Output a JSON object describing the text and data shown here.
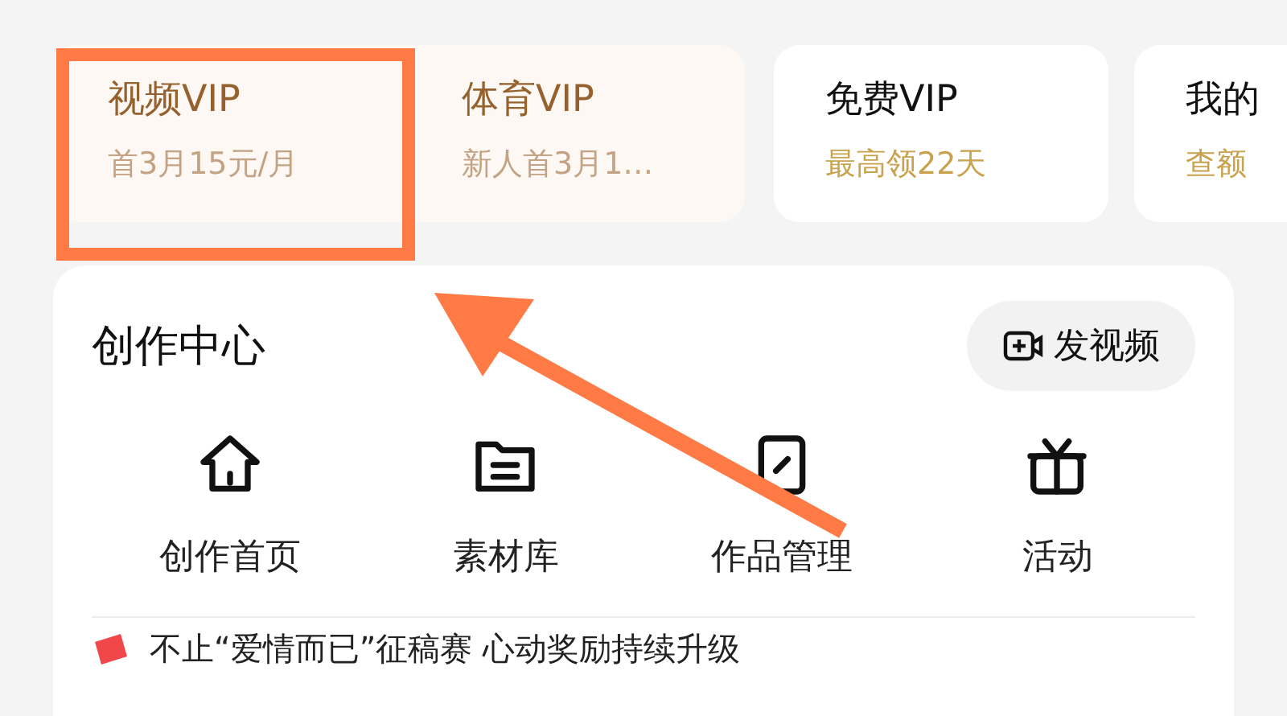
{
  "vip_cards": [
    {
      "title": "视频VIP",
      "subtitle": "首3月15元/月",
      "kind": "premium"
    },
    {
      "title": "体育VIP",
      "subtitle": "新人首3月1…",
      "kind": "premium"
    },
    {
      "title": "免费VIP",
      "subtitle": "最高领22天",
      "kind": "plain"
    },
    {
      "title": "我的",
      "subtitle": "查额",
      "kind": "plain"
    }
  ],
  "creation_center": {
    "title": "创作中心",
    "action_button": {
      "label": "发视频"
    },
    "shortcuts": [
      {
        "label": "创作首页"
      },
      {
        "label": "素材库"
      },
      {
        "label": "作品管理"
      },
      {
        "label": "活动"
      }
    ],
    "banner": {
      "text": "不止“爱情而已”征稿赛 心动奖励持续升级"
    }
  }
}
